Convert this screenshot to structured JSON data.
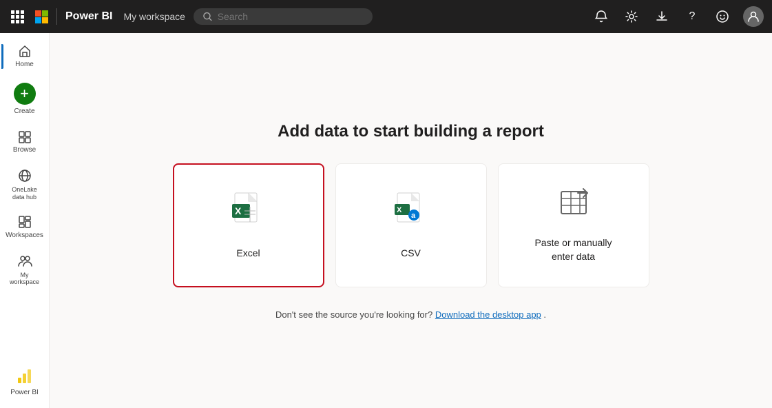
{
  "topnav": {
    "brand": "Power BI",
    "workspace": "My workspace",
    "search_placeholder": "Search"
  },
  "sidebar": {
    "items": [
      {
        "id": "home",
        "label": "Home",
        "icon": "🏠"
      },
      {
        "id": "create",
        "label": "Create",
        "icon": "+",
        "special": true
      },
      {
        "id": "browse",
        "label": "Browse",
        "icon": "📁"
      },
      {
        "id": "onelake",
        "label": "OneLake data hub",
        "icon": "🌐"
      },
      {
        "id": "workspaces",
        "label": "Workspaces",
        "icon": "⬜"
      },
      {
        "id": "myworkspace",
        "label": "My workspace",
        "icon": "👥"
      }
    ],
    "powerbi_label": "Power BI"
  },
  "main": {
    "heading": "Add data to start building a report",
    "cards": [
      {
        "id": "excel",
        "label": "Excel",
        "selected": true
      },
      {
        "id": "csv",
        "label": "CSV",
        "selected": false
      },
      {
        "id": "paste",
        "label": "Paste or manually enter data",
        "selected": false
      }
    ],
    "footer_text": "Don't see the source you're looking for?",
    "footer_link": "Download the desktop app",
    "footer_period": "."
  }
}
